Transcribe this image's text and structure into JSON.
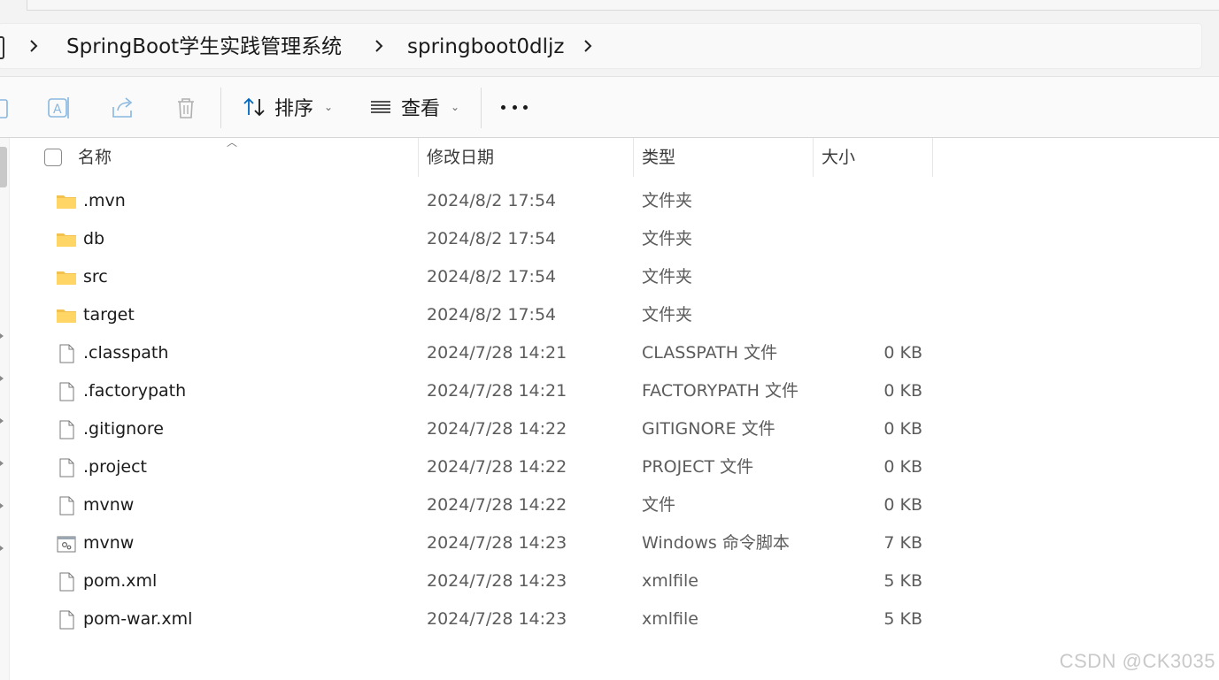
{
  "window": {
    "breadcrumb": [
      {
        "label": "SpringBoot学生实践管理系统"
      },
      {
        "label": "springboot0dljz"
      }
    ]
  },
  "toolbar": {
    "sort_label": "排序",
    "view_label": "查看"
  },
  "columns": {
    "name": "名称",
    "date": "修改日期",
    "type": "类型",
    "size": "大小"
  },
  "files": [
    {
      "name": ".mvn",
      "date": "2024/8/2 17:54",
      "type": "文件夹",
      "size": "",
      "icon": "folder-icon"
    },
    {
      "name": "db",
      "date": "2024/8/2 17:54",
      "type": "文件夹",
      "size": "",
      "icon": "folder-icon"
    },
    {
      "name": "src",
      "date": "2024/8/2 17:54",
      "type": "文件夹",
      "size": "",
      "icon": "folder-icon"
    },
    {
      "name": "target",
      "date": "2024/8/2 17:54",
      "type": "文件夹",
      "size": "",
      "icon": "folder-icon"
    },
    {
      "name": ".classpath",
      "date": "2024/7/28 14:21",
      "type": "CLASSPATH 文件",
      "size": "0 KB",
      "icon": "file-icon"
    },
    {
      "name": ".factorypath",
      "date": "2024/7/28 14:21",
      "type": "FACTORYPATH 文件",
      "size": "0 KB",
      "icon": "file-icon"
    },
    {
      "name": ".gitignore",
      "date": "2024/7/28 14:22",
      "type": "GITIGNORE 文件",
      "size": "0 KB",
      "icon": "file-icon"
    },
    {
      "name": ".project",
      "date": "2024/7/28 14:22",
      "type": "PROJECT 文件",
      "size": "0 KB",
      "icon": "file-icon"
    },
    {
      "name": "mvnw",
      "date": "2024/7/28 14:22",
      "type": "文件",
      "size": "0 KB",
      "icon": "file-icon"
    },
    {
      "name": "mvnw",
      "date": "2024/7/28 14:23",
      "type": "Windows 命令脚本",
      "size": "7 KB",
      "icon": "script-file-icon"
    },
    {
      "name": "pom.xml",
      "date": "2024/7/28 14:23",
      "type": "xmlfile",
      "size": "5 KB",
      "icon": "file-icon"
    },
    {
      "name": "pom-war.xml",
      "date": "2024/7/28 14:23",
      "type": "xmlfile",
      "size": "5 KB",
      "icon": "file-icon"
    }
  ],
  "watermark": "CSDN @CK3035"
}
